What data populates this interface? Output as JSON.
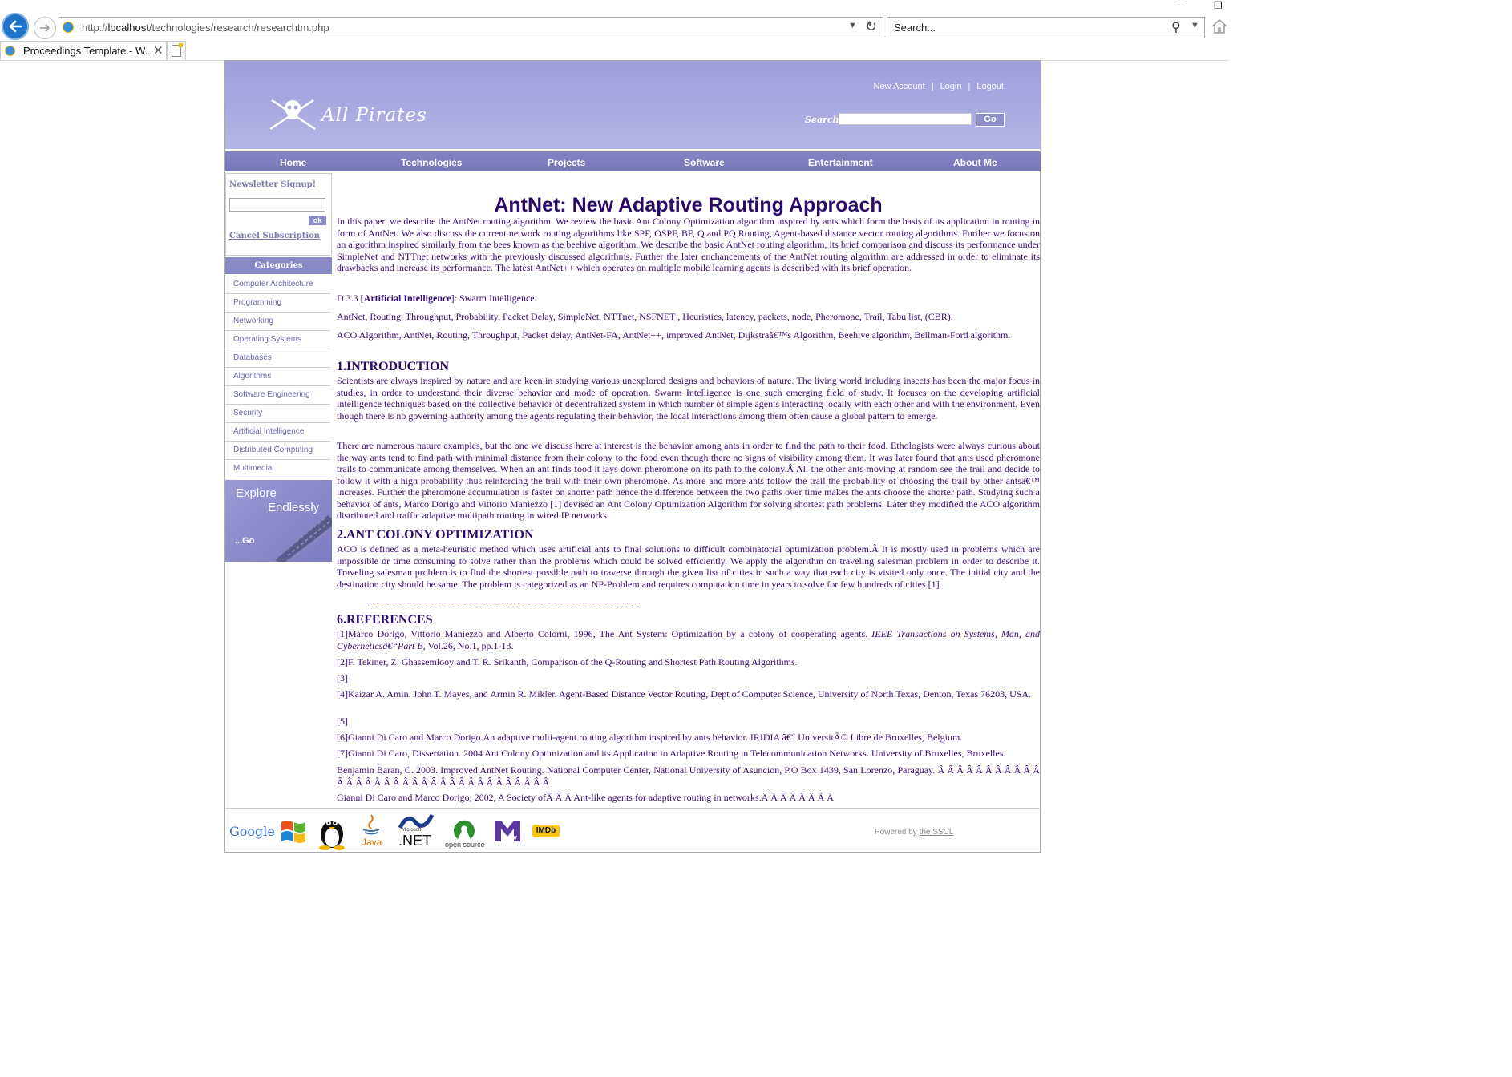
{
  "browser": {
    "url_prefix": "http://",
    "url_host": "localhost",
    "url_path": "/technologies/research/researchtm.php",
    "search_placeholder": "Search...",
    "tab_title": "Proceedings Template - W..."
  },
  "site": {
    "brand": "All Pirates",
    "top_links": [
      "New Account",
      "Login",
      "Logout"
    ],
    "search_label": "Search:",
    "search_button": "Go",
    "nav": [
      "Home",
      "Technologies",
      "Projects",
      "Software",
      "Entertainment",
      "About Me"
    ],
    "newsletter_label": "Newsletter Signup!",
    "newsletter_ok": "ok",
    "cancel_subscription": "Cancel Subscription",
    "categories_heading": "Categories",
    "categories": [
      "Computer Architecture",
      "Programming",
      "Networking",
      "Operating Systems",
      "Databases",
      "Algorithms",
      "Software Engineering",
      "Security",
      "Artificial Intelligence",
      "Distributed Computing",
      "Multimedia"
    ],
    "explore_line1": "Explore",
    "explore_line2": "Endlessly",
    "explore_go": "...Go"
  },
  "article": {
    "title": "AntNet: New Adaptive Routing Approach",
    "abstract": "In this paper, we describe the AntNet routing algorithm. We review the basic Ant Colony Optimization algorithm inspired by ants which form the basis of its application in routing in form of AntNet. We also discuss the current network routing algorithms like SPF, OSPF, BF, Q and PQ Routing, Agent-based distance vector routing algorithms. Further we focus on an algorithm inspired similarly from the bees known as the beehive algorithm. We describe the basic AntNet routing algorithm, its brief comparison and discuss its performance under SimpleNet and NTTnet networks with the previously discussed algorithms. Further the later enchancements of the AntNet routing algorithm are addressed in order to eliminate its drawbacks and increase its performance. The latest AntNet++ which operates on multiple mobile learning agents is described with its brief operation.",
    "category_prefix": "D.3.3 [",
    "category_bold": "Artificial Intelligence",
    "category_suffix": "]: Swarm Intelligence",
    "terms": "AntNet, Routing, Throughput, Probability, Packet Delay, SimpleNet, NTTnet, NSFNET , Heuristics, latency, packets, node, Pheromone, Trail, Tabu list, (CBR).",
    "keywords": "ACO Algorithm, AntNet, Routing, Throughput, Packet delay, AntNet-FA, AntNet++, improved AntNet, Dijkstraâ€™s Algorithm, Beehive algorithm, Bellman-Ford algorithm.",
    "h1": "1.INTRODUCTION",
    "intro_p1": "Scientists are always inspired by nature and are keen in studying various unexplored designs and behaviors of nature. The living world including insects has been the major focus in studies, in order to understand their diverse behavior and mode of operation. Swarm Intelligence is one such emerging field of study. It focuses on the developing artificial intelligence techniques based on the collective behavior of decentralized system in which number of simple agents interacting locally with each other and with the environment. Even though there is no governing authority among the agents regulating their behavior, the local interactions among them often cause a global pattern to emerge.",
    "intro_p2": "There are numerous nature examples, but the one we discuss here at interest is the behavior among ants in order to find the path to their food. Ethologists were always curious about the way ants tend to find path with minimal distance from their colony to the food even though there no signs of visibility among them. It was later found that ants used pheromone trails to communicate among themselves. When an ant finds food it lays down pheromone on its path to the colony.Â  All the other ants moving at random see the trail and decide to follow it with a high probability thus reinforcing the trail with their own pheromone. As more and more ants follow the trail the probability of choosing the trail by other antsâ€™ increases. Further the pheromone accumulation is faster on shorter path hence the difference between the two paths over time makes the ants choose the shorter path. Studying such a behavior of ants, Marco Dorigo and Vittorio Maniezzo [1] devised an Ant Colony Optimization Algorithm for solving shortest path problems. Later they modified the ACO algorithm distributed and traffic adaptive multipath routing in wired IP networks.",
    "h2": "2.ANT COLONY OPTIMIZATION",
    "aco_p1": "ACO is defined as a meta-heuristic method which uses artificial ants to final solutions to difficult combinatorial optimization problem.Â  It is mostly used in problems which are impossible or time consuming to solve rather than the problems which could be solved efficiently. We apply the algorithm on traveling salesman problem in order to describe it. Traveling salesman problem is to find the shortest possible path to traverse through the given list of cities in such a way that each city is visited only once. The initial city and the destination city should be same. The problem is categorized as an NP-Problem and requires computation time in years to solve for few hundreds of cities [1].",
    "h6": "6.REFERENCES",
    "ref1_a": "[1]Marco Dorigo, Vittorio Maniezzo and Alberto Colorni, 1996, The Ant System: Optimization by a colony of cooperating agents. ",
    "ref1_i": "IEEE Transactions on Systems, Man, and Cyberneticsâ€“Part B",
    "ref1_b": ", Vol.26, No.1, pp.1-13.",
    "ref2": "[2]F. Tekiner, Z. Ghassemlooy and T. R. Srikanth, Comparison of the Q-Routing and Shortest Path Routing Algorithms.",
    "ref3": "[3]",
    "ref4": "[4]Kaizar A. Amin. John T. Mayes, and Armin R. Mikler. Agent-Based Distance Vector Routing, Dept of Computer Science, University of North Texas, Denton, Texas 76203, USA.",
    "ref5": "[5]",
    "ref6": "[6]Gianni Di Caro and Marco Dorigo.An adaptive multi-agent routing algorithm inspired by ants behavior. IRIDIA â€“ UniversitÃ© Libre de Bruxelles, Belgium.",
    "ref7": "[7]Gianni Di Caro, Dissertation. 2004 Ant Colony Optimization and its Application to Adaptive Routing in Telecommunication Networks. University of Bruxelles, Bruxelles.",
    "ref8": "Benjamin Baran, C. 2003. Improved AntNet Routing. National Computer Center, National University of Asuncion, P.O Box 1439, San Lorenzo, Paraguay. Â Â Â Â Â Â Â Â Â Â Â Â Â Â Â Â Â Â Â Â Â Â Â Â Â Â Â Â Â Â Â Â Â Â",
    "ref9": "Gianni Di Caro and Marco Dorigo, 2002, A Society ofÂ Â Â  Ant-like agents for adaptive routing in networks.Â Â Â Â Â Â Â Â"
  },
  "footer": {
    "google": "Google",
    "java": "Java",
    "dotnet_small": "Microsoft",
    "dotnet": ".NET",
    "opensource": "open source",
    "imdb": "IMDb",
    "powered_prefix": "Powered by ",
    "powered_link": "the SSCL"
  }
}
